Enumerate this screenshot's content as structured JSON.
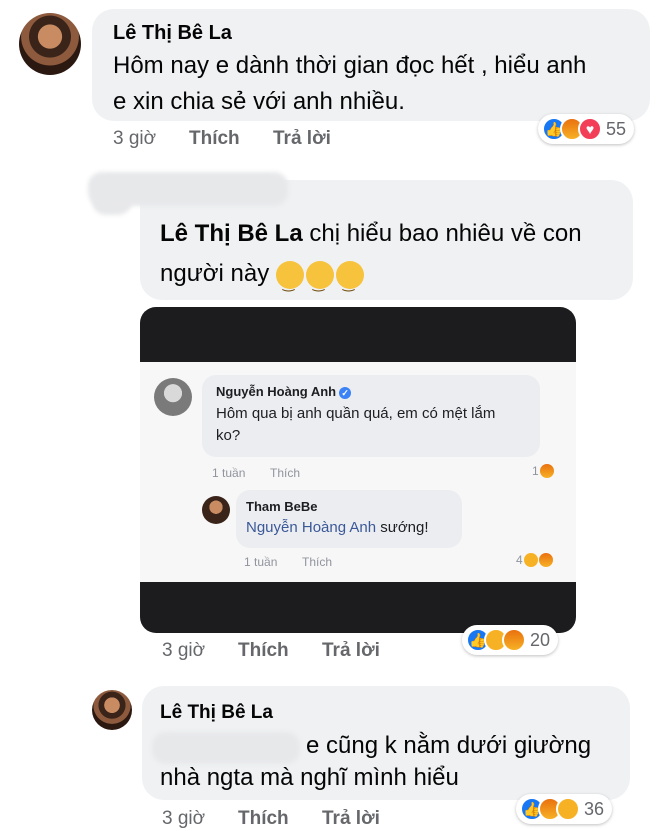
{
  "comment1": {
    "author": "Lê Thị Bê La",
    "text_line1": "Hôm nay e dành thời gian đọc hết , hiểu anh",
    "text_line2": "e xin chia sẻ với anh nhiều.",
    "time": "3 giờ",
    "like_label": "Thích",
    "reply_label": "Trả lời",
    "reaction_count": "55"
  },
  "comment2": {
    "tagged_name": "Lê Thị Bê La",
    "text_line1": "chị hiểu bao nhiêu về con",
    "text_line2": "người này",
    "time": "3 giờ",
    "like_label": "Thích",
    "reply_label": "Trả lời",
    "reaction_count": "20",
    "embedded": {
      "c1_author": "Nguyễn Hoàng Anh",
      "c1_line1": "Hôm qua bị anh quần quá, em có mệt lắm",
      "c1_line2": "ko?",
      "c1_time": "1 tuần",
      "c1_like": "Thích",
      "c1_count": "1",
      "c2_author": "Tham BeBe",
      "c2_tag": "Nguyễn Hoàng Anh",
      "c2_text": "sướng!",
      "c2_time": "1 tuần",
      "c2_like": "Thích",
      "c2_count": "4"
    }
  },
  "comment3": {
    "author": "Lê Thị Bê La",
    "text_line1": "e cũng k nằm dưới giường",
    "text_line2": "nhà ngta mà nghĩ mình hiểu",
    "time": "3 giờ",
    "like_label": "Thích",
    "reply_label": "Trả lời",
    "reaction_count": "36"
  },
  "icons": {
    "like": "like-icon",
    "angry": "angry-icon",
    "love": "love-icon",
    "haha": "haha-icon",
    "smirk": "smirk-emoji"
  }
}
